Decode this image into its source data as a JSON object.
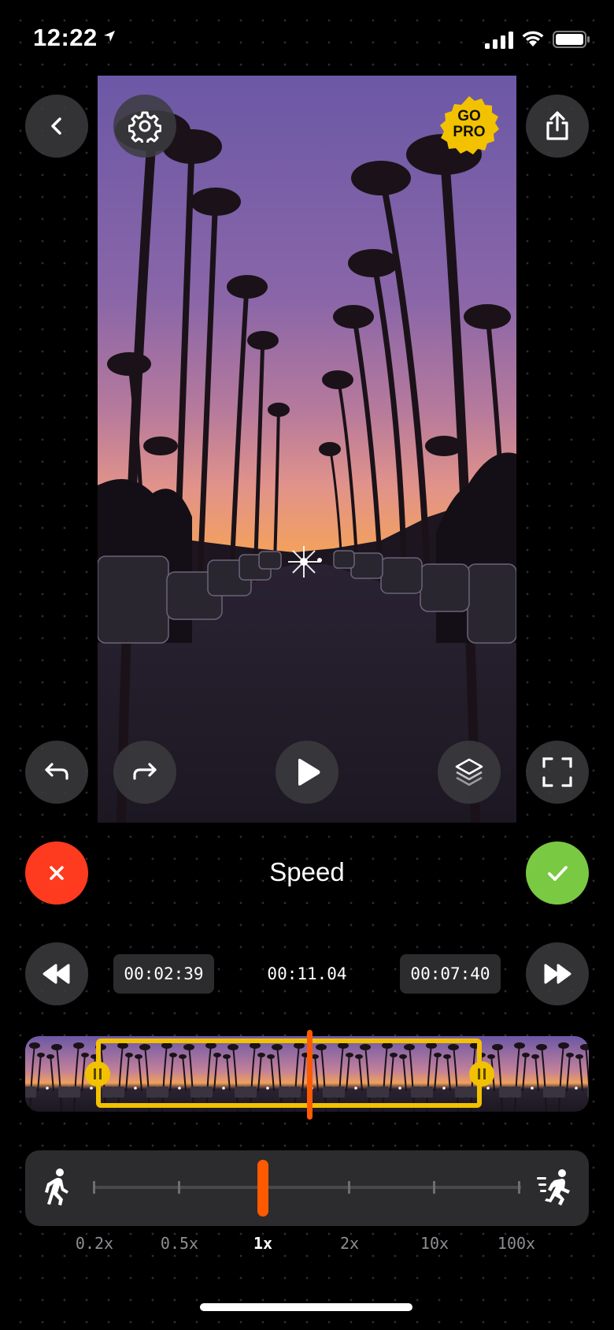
{
  "status_bar": {
    "time": "12:22"
  },
  "top_controls": {
    "go_pro_line1": "GO",
    "go_pro_line2": "PRO"
  },
  "editor": {
    "title": "Speed",
    "start_time": "00:02:39",
    "current_time": "00:11.04",
    "end_time": "00:07:40"
  },
  "speed_control": {
    "labels": [
      "0.2x",
      "0.5x",
      "1x",
      "2x",
      "10x",
      "100x"
    ],
    "selected": "1x"
  },
  "colors": {
    "cancel": "#ff3b1f",
    "confirm": "#7ac943",
    "accent": "#ff5a00",
    "trim": "#f2c200"
  }
}
